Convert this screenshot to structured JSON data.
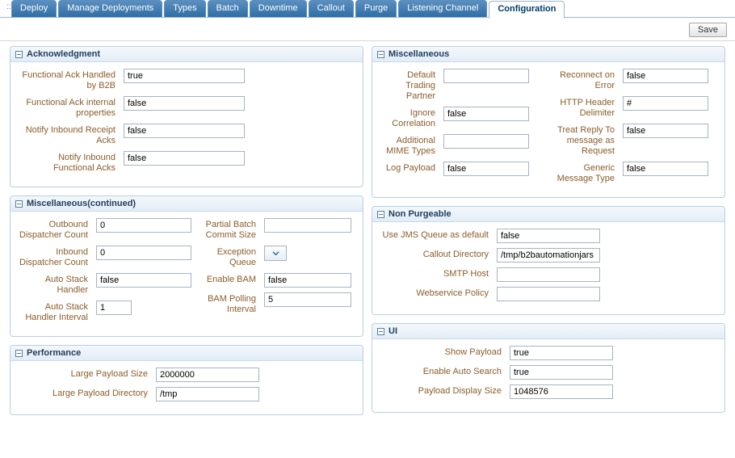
{
  "tabs": {
    "items": [
      {
        "label": "Deploy"
      },
      {
        "label": "Manage Deployments"
      },
      {
        "label": "Types"
      },
      {
        "label": "Batch"
      },
      {
        "label": "Downtime"
      },
      {
        "label": "Callout"
      },
      {
        "label": "Purge"
      },
      {
        "label": "Listening Channel"
      },
      {
        "label": "Configuration"
      }
    ],
    "activeIndex": 8
  },
  "toolbar": {
    "save_label": "Save"
  },
  "panels": {
    "ack": {
      "title": "Acknowledgment",
      "fields": {
        "func_ack_b2b": {
          "label": "Functional Ack Handled by B2B",
          "value": "true"
        },
        "func_ack_internal": {
          "label": "Functional Ack internal properties",
          "value": "false"
        },
        "notify_inbound_receipt": {
          "label": "Notify Inbound Receipt Acks",
          "value": "false"
        },
        "notify_inbound_functional": {
          "label": "Notify Inbound Functional Acks",
          "value": "false"
        }
      }
    },
    "misc": {
      "title": "Miscellaneous",
      "left": {
        "default_trading_partner": {
          "label": "Default Trading Partner",
          "value": ""
        },
        "ignore_correlation": {
          "label": "Ignore Correlation",
          "value": "false"
        },
        "additional_mime": {
          "label": "Additional MIME Types",
          "value": ""
        },
        "log_payload": {
          "label": "Log Payload",
          "value": "false"
        }
      },
      "right": {
        "reconnect_on_error": {
          "label": "Reconnect on Error",
          "value": "false"
        },
        "http_header_delimiter": {
          "label": "HTTP Header Delimiter",
          "value": "#"
        },
        "treat_reply": {
          "label": "Treat Reply To message as Request",
          "value": "false"
        },
        "generic_message_type": {
          "label": "Generic Message Type",
          "value": "false"
        }
      }
    },
    "misc2": {
      "title": "Miscellaneous(continued)",
      "left": {
        "outbound_dispatcher": {
          "label": "Outbound Dispatcher Count",
          "value": "0"
        },
        "inbound_dispatcher": {
          "label": "Inbound Dispatcher Count",
          "value": "0"
        },
        "auto_stack_handler": {
          "label": "Auto Stack Handler",
          "value": "false"
        },
        "auto_stack_interval": {
          "label": "Auto Stack Handler Interval",
          "value": "1"
        }
      },
      "right": {
        "partial_batch": {
          "label": "Partial Batch Commit Size",
          "value": ""
        },
        "exception_queue": {
          "label": "Exception Queue",
          "value": ""
        },
        "enable_bam": {
          "label": "Enable BAM",
          "value": "false"
        },
        "bam_polling": {
          "label": "BAM Polling Interval",
          "value": "5"
        }
      }
    },
    "nonpurge": {
      "title": "Non Purgeable",
      "fields": {
        "use_jms": {
          "label": "Use JMS Queue as default",
          "value": "false"
        },
        "callout_dir": {
          "label": "Callout Directory",
          "value": "/tmp/b2bautomationjars"
        },
        "smtp_host": {
          "label": "SMTP Host",
          "value": ""
        },
        "webservice_policy": {
          "label": "Webservice Policy",
          "value": ""
        }
      }
    },
    "performance": {
      "title": "Performance",
      "fields": {
        "large_payload_size": {
          "label": "Large Payload Size",
          "value": "2000000"
        },
        "large_payload_dir": {
          "label": "Large Payload Directory",
          "value": "/tmp"
        }
      }
    },
    "ui": {
      "title": "UI",
      "fields": {
        "show_payload": {
          "label": "Show Payload",
          "value": "true"
        },
        "enable_auto_search": {
          "label": "Enable Auto Search",
          "value": "true"
        },
        "payload_display_size": {
          "label": "Payload Display Size",
          "value": "1048576"
        }
      }
    }
  }
}
